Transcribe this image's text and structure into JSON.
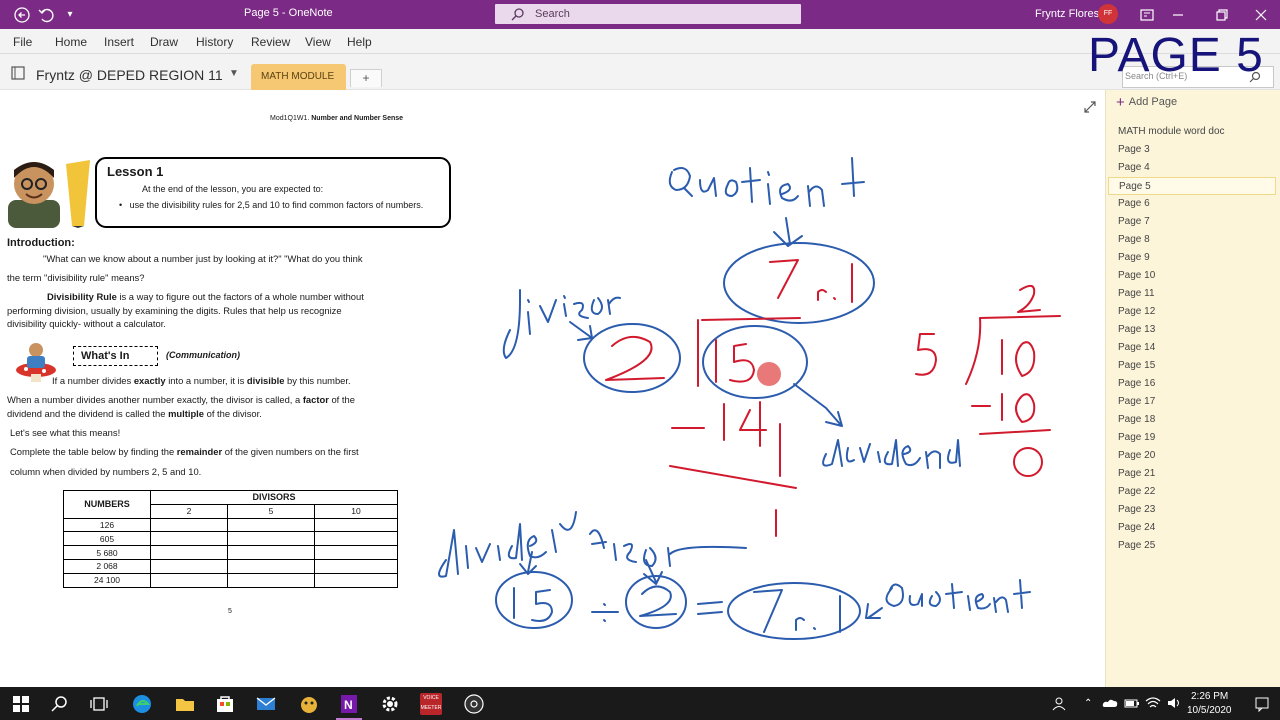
{
  "window": {
    "title": "Page 5  -  OneNote",
    "search_placeholder": "Search",
    "user_name": "Fryntz Flores",
    "user_initials": "FF",
    "accent_color": "#7b2a85"
  },
  "menu": [
    "File",
    "Home",
    "Insert",
    "Draw",
    "History",
    "Review",
    "View",
    "Help"
  ],
  "notebook": {
    "name": "Fryntz @ DEPED REGION 11",
    "section_tab": "MATH MODULE",
    "add_section": "+",
    "page_search_placeholder": "Search (Ctrl+E)"
  },
  "overlay_title": "PAGE 5",
  "document": {
    "module_code": "Mod1Q1W1.",
    "module_title": "Number and Number Sense",
    "lesson_title": "Lesson 1",
    "lesson_expect": "At the end of the lesson, you are expected to:",
    "lesson_bullet": "use the divisibility rules for 2,5 and 10 to find common factors of  numbers.",
    "intro_heading": "Introduction:",
    "intro_q1": "\"What can we know about a number just by looking at it?\" \"What do you think",
    "intro_q2": "the term \"divisibility rule\" means?",
    "rule_bold": "Divisibility Rule",
    "rule_rest": " is a way to figure out the factors of a whole number without",
    "rule_line2": "performing division, usually by examining the digits. Rules that help us recognize",
    "rule_line3": "divisibility quickly- without a calculator.",
    "whats_in": "What's In",
    "communication": "(Communication)",
    "p1_a": "If a number divides ",
    "p1_b": "exactly",
    "p1_c": " into a number, it is ",
    "p1_d": "divisible",
    "p1_e": " by this number.",
    "p2_a": "When a number divides another number exactly, the divisor is called, a ",
    "p2_b": "factor",
    "p2_c": " of the",
    "p2_d": "dividend and the dividend is called the ",
    "p2_e": "multiple",
    "p2_f": " of the divisor.",
    "p3": "Let's see what this means!",
    "p4_a": "Complete the table below by finding the ",
    "p4_b": "remainder",
    "p4_c": " of the given numbers on the first",
    "p5": "column when divided by numbers 2, 5 and 10.",
    "table": {
      "col_numbers": "NUMBERS",
      "col_divisors": "DIVISORS",
      "divisors": [
        "2",
        "5",
        "10"
      ],
      "numbers": [
        "126",
        "605",
        "5 680",
        "2 068",
        "24 100"
      ]
    },
    "page_number": "5"
  },
  "pages_pane": {
    "add_page": "Add Page",
    "pages": [
      "MATH module word doc",
      "Page 3",
      "Page 4",
      "Page 5",
      "Page 6",
      "Page 7",
      "Page 8",
      "Page 9",
      "Page 10",
      "Page 11",
      "Page 12",
      "Page 13",
      "Page 14",
      "Page 15",
      "Page 16",
      "Page 17",
      "Page 18",
      "Page 19",
      "Page 20",
      "Page 21",
      "Page 22",
      "Page 23",
      "Page 24",
      "Page 25"
    ],
    "selected": "Page 5"
  },
  "taskbar": {
    "time": "2:26 PM",
    "date": "10/5/2020",
    "voicemeeter_label_top": "VOICE",
    "voicemeeter_label_bottom": "MEETER"
  }
}
